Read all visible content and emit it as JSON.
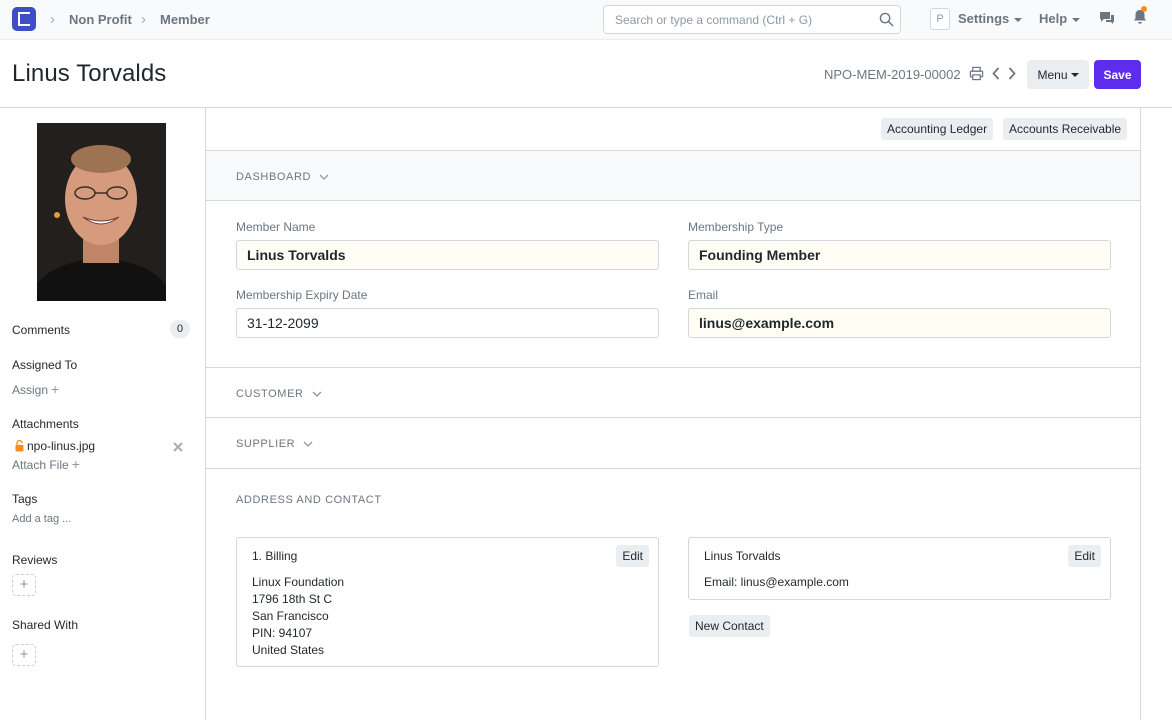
{
  "navbar": {
    "breadcrumbs": [
      "Non Profit",
      "Member"
    ],
    "search_placeholder": "Search or type a command (Ctrl + G)",
    "avatar_initial": "P",
    "settings_label": "Settings",
    "help_label": "Help"
  },
  "page": {
    "title": "Linus Torvalds",
    "docname": "NPO-MEM-2019-00002",
    "menu_label": "Menu",
    "save_label": "Save"
  },
  "sidebar": {
    "comments_label": "Comments",
    "comments_count": "0",
    "assigned_to_label": "Assigned To",
    "assign_link": "Assign",
    "attachments_label": "Attachments",
    "attachment_file": "npo-linus.jpg",
    "attach_file_link": "Attach File",
    "tags_label": "Tags",
    "add_tag_link": "Add a tag ...",
    "reviews_label": "Reviews",
    "shared_with_label": "Shared With"
  },
  "dashboard": {
    "buttons": [
      "Accounting Ledger",
      "Accounts Receivable"
    ]
  },
  "sections": {
    "dashboard": "DASHBOARD",
    "customer": "CUSTOMER",
    "supplier": "SUPPLIER",
    "address_contact": "ADDRESS AND CONTACT"
  },
  "form": {
    "member_name_label": "Member Name",
    "member_name_value": "Linus Torvalds",
    "membership_type_label": "Membership Type",
    "membership_type_value": "Founding Member",
    "expiry_label": "Membership Expiry Date",
    "expiry_value": "31-12-2099",
    "email_label": "Email",
    "email_value": "linus@example.com"
  },
  "address_card": {
    "title": "1. Billing",
    "edit_label": "Edit",
    "lines": [
      "Linux Foundation",
      "1796 18th St C",
      "San Francisco",
      "PIN: 94107",
      "United States"
    ]
  },
  "contact_card": {
    "title": "Linus Torvalds",
    "edit_label": "Edit",
    "email_line": "Email: linus@example.com",
    "new_contact_label": "New Contact"
  },
  "colors": {
    "primary": "#5e2ced",
    "logo": "#3e4ec7",
    "notification": "#ff8c1a"
  }
}
